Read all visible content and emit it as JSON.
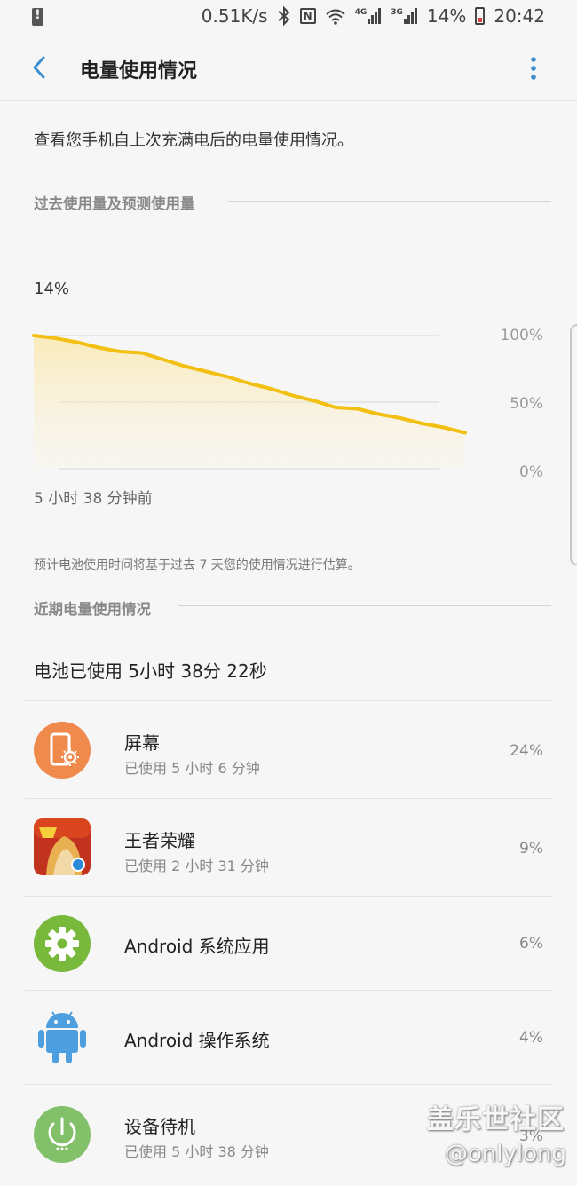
{
  "status_bar": {
    "net_speed": "0.51K/s",
    "nfc_letter": "N",
    "lte_1": "4G",
    "lte_2": "3G",
    "battery": "14%",
    "time": "20:42"
  },
  "app_bar": {
    "title": "电量使用情况"
  },
  "intro": "查看您手机自上次充满电后的电量使用情况。",
  "history_section": {
    "title": "过去使用量及预测使用量",
    "current_level": "14%",
    "axis_labels": [
      "100%",
      "50%",
      "0%"
    ],
    "time_ago": "5 小时 38 分钟前",
    "estimate_note": "预计电池使用时间将基于过去 7 天您的使用情况进行估算。"
  },
  "chart_data": {
    "type": "area",
    "ylim": [
      0,
      100
    ],
    "y_tick_labels": [
      "100%",
      "50%",
      "0%"
    ],
    "series": [
      {
        "x": [
          0,
          1,
          2,
          3,
          4,
          5,
          6,
          7,
          8,
          9,
          10,
          11,
          12,
          13,
          14,
          15,
          16,
          17,
          18,
          19,
          20
        ],
        "values": [
          100,
          98,
          95,
          91,
          88,
          87,
          82,
          77,
          73,
          69,
          64,
          60,
          55,
          51,
          46,
          45,
          41,
          38,
          34,
          31,
          27
        ]
      }
    ],
    "colors": {
      "line": "#f2c012",
      "fill": "#fdf3d2"
    }
  },
  "recent_section": {
    "title": "近期电量使用情况",
    "total_used": "电池已使用 5小时 38分 22秒"
  },
  "usage_items": [
    {
      "name": "屏幕",
      "sub": "已使用 5 小时 6 分钟",
      "percent": "24%",
      "icon": "screen-brightness-icon",
      "color": "#ef8a4c"
    },
    {
      "name": "王者荣耀",
      "sub": "已使用 2 小时 31 分钟",
      "percent": "9%",
      "icon": "game-app-icon",
      "color": "#c2331f"
    },
    {
      "name": "Android 系统应用",
      "sub": "",
      "percent": "6%",
      "icon": "gear-icon",
      "color": "#78b83a"
    },
    {
      "name": "Android 操作系统",
      "sub": "",
      "percent": "4%",
      "icon": "android-robot-icon",
      "color": "#4d9fe0"
    },
    {
      "name": "设备待机",
      "sub": "已使用 5 小时 38 分钟",
      "percent": "3%",
      "icon": "power-icon",
      "color": "#83c06a"
    }
  ],
  "watermark": {
    "line1": "盖乐世社区",
    "line2": "@onlylong"
  }
}
